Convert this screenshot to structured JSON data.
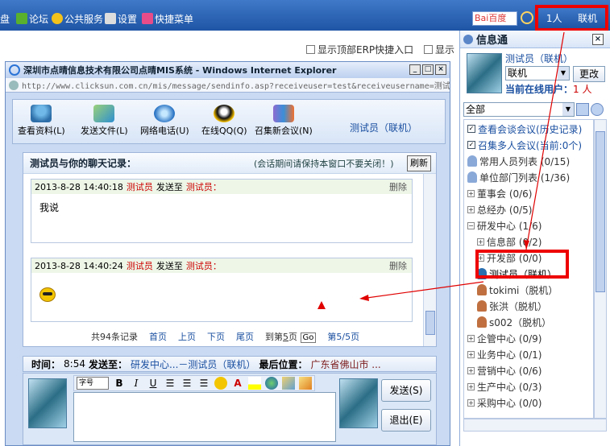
{
  "topbar": {
    "items": [
      {
        "label": "盘",
        "icon": "disk-icon",
        "color": "#4a90e2"
      },
      {
        "label": "论坛",
        "icon": "forum-icon",
        "color": "#58b02e"
      },
      {
        "label": "公共服务",
        "icon": "public-service-icon",
        "color": "#f3c21b"
      },
      {
        "label": "设置",
        "icon": "tools-icon",
        "color": "#dddddd"
      },
      {
        "label": "快捷菜单",
        "icon": "shortcut-menu-icon",
        "color": "#e84d8a"
      }
    ],
    "search_label": "Bai百度",
    "online_count": "1人",
    "status": "联机"
  },
  "checkboxes": [
    {
      "label": "显示顶部ERP快捷入口"
    },
    {
      "label": "显示"
    }
  ],
  "ie": {
    "title": "深圳市点晴信息技术有限公司点晴MIS系统 - Windows Internet Explorer",
    "address": "http://www.clicksun.com.cn/mis/message/sendinfo.asp?receiveuser=test&receiveusername=测试员",
    "win_buttons": [
      "_",
      "□",
      "×"
    ]
  },
  "toolbar": {
    "tools": [
      {
        "label": "查看资料(L)",
        "icon": "user-profile-icon"
      },
      {
        "label": "发送文件(L)",
        "icon": "send-file-icon"
      },
      {
        "label": "网络电话(U)",
        "icon": "voip-phone-icon"
      },
      {
        "label": "在线QQ(Q)",
        "icon": "qq-penguin-icon"
      },
      {
        "label": "召集新会议(N)",
        "icon": "meeting-icon"
      }
    ],
    "peer": "测试员（联机）"
  },
  "chat": {
    "title": "测试员与你的聊天记录：",
    "note": "(会话期间请保持本窗口不要关闭！)",
    "refresh": "刷新",
    "messages": [
      {
        "time": "2013-8-28 14:40:18",
        "from": "测试员",
        "verb": "发送至",
        "to": "测试员：",
        "del": "删除",
        "body": "我说"
      },
      {
        "time": "2013-8-28 14:40:24",
        "from": "测试员",
        "verb": "发送至",
        "to": "测试员：",
        "del": "删除",
        "body": ""
      }
    ],
    "pager": {
      "total": "共94条记录",
      "first": "首页",
      "prev": "上页",
      "next": "下页",
      "last": "尾页",
      "goto_prefix": "到第",
      "goto_value": "5",
      "goto_suffix": "页",
      "go": "Go",
      "page_info": "第5/5页"
    }
  },
  "status": {
    "time_label": "时间：",
    "time": "8:54",
    "send_label": "发送至：",
    "send_to": "研发中心...－测试员（联机）",
    "pos_label": "最后位置：",
    "position": "广东省佛山市 ..."
  },
  "compose": {
    "font_select": "字号",
    "bold": "B",
    "italic": "I",
    "underline": "U",
    "send": "发送(S)",
    "exit": "退出(E)"
  },
  "side": {
    "title": "信息通",
    "close": "×",
    "user": "测试员（联机）",
    "status_value": "联机",
    "change": "更改",
    "online_label": "当前在线用户：",
    "online_count": "1 人",
    "filter": "全部",
    "tree": [
      {
        "label": "查看会谈会议(历史记录)",
        "type": "check",
        "color": "#1a4fa0",
        "depth": 0
      },
      {
        "label": "召集多人会议(当前:0个)",
        "type": "check",
        "color": "#1a4fa0",
        "depth": 0
      },
      {
        "label": "常用人员列表 (0/15)",
        "type": "group-icon",
        "color": "#333333",
        "depth": 0
      },
      {
        "label": "单位部门列表 (1/36)",
        "type": "group-icon",
        "color": "#333333",
        "depth": 0
      },
      {
        "label": "董事会 (0/6)",
        "type": "plus",
        "color": "#333333",
        "depth": 0
      },
      {
        "label": "总经办 (0/5)",
        "type": "plus",
        "color": "#333333",
        "depth": 0
      },
      {
        "label": "研发中心 (1/6)",
        "type": "minus",
        "color": "#333333",
        "depth": 0
      },
      {
        "label": "信息部 (0/2)",
        "type": "plus",
        "color": "#333333",
        "depth": 1
      },
      {
        "label": "开发部 (0/0)",
        "type": "plus",
        "color": "#333333",
        "depth": 1
      },
      {
        "label": "测试员（联机）",
        "type": "user-online",
        "color": "#000000",
        "depth": 1
      },
      {
        "label": "tokimi（脱机）",
        "type": "user-offline",
        "color": "#333333",
        "depth": 1
      },
      {
        "label": "张洪（脱机）",
        "type": "user-offline",
        "color": "#333333",
        "depth": 1
      },
      {
        "label": "s002（脱机）",
        "type": "user-offline",
        "color": "#333333",
        "depth": 1
      },
      {
        "label": "企管中心 (0/9)",
        "type": "plus",
        "color": "#333333",
        "depth": 0
      },
      {
        "label": "业务中心 (0/1)",
        "type": "plus",
        "color": "#333333",
        "depth": 0
      },
      {
        "label": "营销中心 (0/6)",
        "type": "plus",
        "color": "#333333",
        "depth": 0
      },
      {
        "label": "生产中心 (0/3)",
        "type": "plus",
        "color": "#333333",
        "depth": 0
      },
      {
        "label": "采购中心 (0/0)",
        "type": "plus",
        "color": "#333333",
        "depth": 0
      }
    ]
  },
  "colors": {
    "highlight": "#e00000",
    "online_user": "#2a6fb0",
    "offline_user": "#c07040"
  }
}
